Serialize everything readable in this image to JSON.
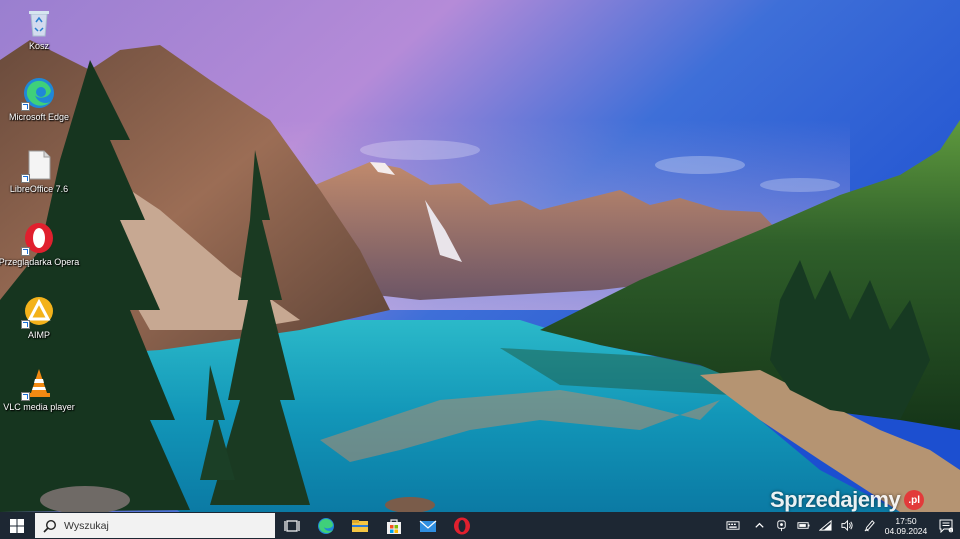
{
  "desktop": {
    "icons": [
      {
        "label": "Kosz",
        "icon": "recycle-bin-icon"
      },
      {
        "label": "Microsoft Edge",
        "icon": "edge-icon"
      },
      {
        "label": "LibreOffice 7.6",
        "icon": "libreoffice-icon"
      },
      {
        "label": "Przeglądarka Opera",
        "icon": "opera-icon"
      },
      {
        "label": "AIMP",
        "icon": "aimp-icon"
      },
      {
        "label": "VLC media player",
        "icon": "vlc-icon"
      }
    ]
  },
  "watermark": {
    "text": "Sprzedajemy",
    "badge": ".pl"
  },
  "taskbar": {
    "search_placeholder": "Wyszukaj",
    "pinned": [
      "task-view-icon",
      "edge-icon",
      "file-explorer-icon",
      "store-icon",
      "mail-icon",
      "opera-icon"
    ],
    "tray_icons": [
      "virtual-keyboard-icon",
      "chevron-up-icon",
      "webcam-icon",
      "battery-icon",
      "wifi-icon",
      "volume-icon",
      "pen-icon"
    ],
    "clock": {
      "time": "17:50",
      "date": "04.09.2024"
    }
  },
  "colors": {
    "taskbar": "#1d2733",
    "search_bg": "#f2f2f2",
    "accent": "#1a6fd6"
  }
}
